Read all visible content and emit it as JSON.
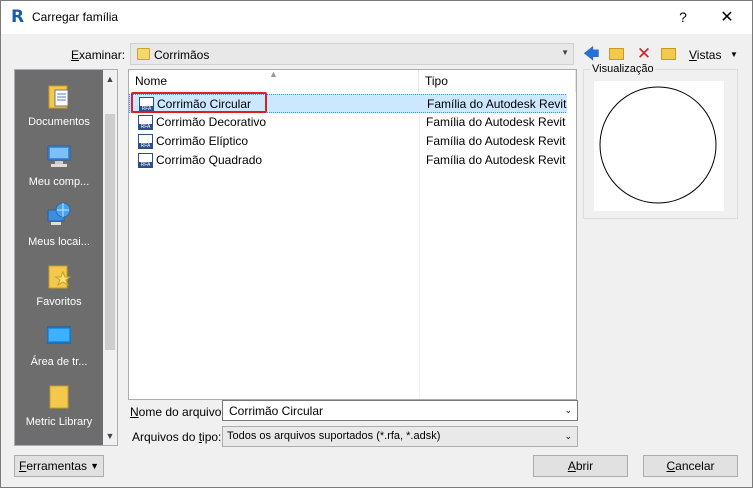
{
  "window": {
    "title": "Carregar família",
    "help_label": "?",
    "close_label": "✕"
  },
  "look_in": {
    "label_accel": "E",
    "label_rest": "xaminar:",
    "value": "Corrimãos"
  },
  "toolbar": {
    "views_accel": "V",
    "views_rest": "istas"
  },
  "places": [
    {
      "label": "Documentos",
      "icon": "documents-icon"
    },
    {
      "label": "Meu comp...",
      "icon": "computer-icon"
    },
    {
      "label": "Meus locai...",
      "icon": "network-places-icon"
    },
    {
      "label": "Favoritos",
      "icon": "favorites-icon"
    },
    {
      "label": "Área de tr...",
      "icon": "desktop-icon"
    },
    {
      "label": "Metric Library",
      "icon": "library-folder-icon"
    }
  ],
  "filelist": {
    "columns": {
      "name": "Nome",
      "type": "Tipo"
    },
    "rows": [
      {
        "name": "Corrimão Circular",
        "type": "Família do Autodesk Revit",
        "selected": true
      },
      {
        "name": "Corrimão Decorativo",
        "type": "Família do Autodesk Revit",
        "selected": false
      },
      {
        "name": "Corrimão Elíptico",
        "type": "Família do Autodesk Revit",
        "selected": false
      },
      {
        "name": "Corrimão Quadrado",
        "type": "Família do Autodesk Revit",
        "selected": false
      }
    ]
  },
  "preview": {
    "label": "Visualização"
  },
  "filename": {
    "label_accel": "N",
    "label_rest": "ome do arquivo:",
    "value": "Corrimão Circular"
  },
  "filetype": {
    "label_pre": "Arquivos do ",
    "label_accel": "t",
    "label_rest": "ipo:",
    "value": "Todos os arquivos suportados  (*.rfa, *.adsk)"
  },
  "buttons": {
    "tools_accel": "F",
    "tools_rest": "erramentas",
    "open_accel": "A",
    "open_rest": "brir",
    "cancel_pre": "",
    "cancel_accel": "C",
    "cancel_rest": "ancelar"
  }
}
